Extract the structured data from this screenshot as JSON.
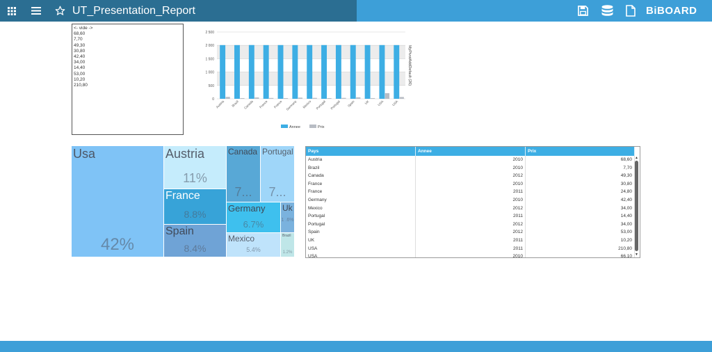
{
  "header": {
    "title": "UT_Presentation_Report",
    "brand": "BiBOARD",
    "icons": [
      "apps-grid-icon",
      "menu-icon",
      "star-icon",
      "save-icon",
      "database-icon",
      "copy-document-icon"
    ]
  },
  "colors": {
    "topbar": "#3d9fd8",
    "title_zone": "#2b6e92",
    "accent": "#3daee4"
  },
  "filter_list": {
    "items": [
      "<- vide ->",
      "68,60",
      "7,70",
      "49,30",
      "30,80",
      "42,40",
      "34,00",
      "14,40",
      "53,00",
      "10,20",
      "210,80"
    ]
  },
  "chart_data": {
    "type": "bar",
    "categories": [
      "Austria",
      "Brazil",
      "Canada",
      "France",
      "France",
      "Germany",
      "Mexico",
      "Portugal",
      "Portugal",
      "Spain",
      "UK",
      "USA",
      "USA"
    ],
    "series": [
      {
        "name": "Annee",
        "color": "#3daee4",
        "values": [
          2010,
          2010,
          2012,
          2010,
          2011,
          2010,
          2012,
          2011,
          2012,
          2012,
          2011,
          2011,
          2010
        ]
      },
      {
        "name": "Prix",
        "color": "#b8bcc4",
        "values": [
          68.6,
          7.7,
          49.3,
          30.8,
          24.8,
          42.4,
          34.0,
          14.4,
          34.0,
          53.0,
          10.2,
          210.8,
          66.1
        ]
      }
    ],
    "yticks": [
      "0",
      "500",
      "1 000",
      "1 500",
      "2 000",
      "2 500"
    ],
    "ylim": [
      0,
      2500
    ],
    "ylabel": "MyPivotAddDefault (26)",
    "grid": true,
    "legend": "bottom"
  },
  "treemap": {
    "cells": [
      {
        "name": "Usa",
        "pct": "42%",
        "color": "#7fc3f6",
        "text": "#4d5766"
      },
      {
        "name": "Austria",
        "pct": "11%",
        "color": "#c5ecfc",
        "text": "#555e6b"
      },
      {
        "name": "France",
        "pct": "8.8%",
        "color": "#37a3d8",
        "text": "#ffffff"
      },
      {
        "name": "Spain",
        "pct": "8.4%",
        "color": "#6fa3d6",
        "text": "#404a5a"
      },
      {
        "name": "Canada",
        "pct": "7...",
        "color": "#58a8d6",
        "text": "#3e4856"
      },
      {
        "name": "Portugal",
        "pct": "7...",
        "color": "#9fd6f9",
        "text": "#555e6b"
      },
      {
        "name": "Germany",
        "pct": "6.7%",
        "color": "#3ec0ee",
        "text": "#3e4856"
      },
      {
        "name": "Uk",
        "pct": "1 .6%",
        "color": "#7ab2de",
        "text": "#3e4856"
      },
      {
        "name": "Mexico",
        "pct": "5.4%",
        "color": "#bfe3fb",
        "text": "#555e6b"
      },
      {
        "name": "Brazil",
        "pct": "1.2%",
        "color": "#bfe6e8",
        "text": "#555e6b"
      }
    ]
  },
  "table": {
    "columns": [
      "Pays",
      "Annee",
      "Prix"
    ],
    "rows": [
      [
        "Austria",
        "2010",
        "68,60"
      ],
      [
        "Brazil",
        "2010",
        "7,70"
      ],
      [
        "Canada",
        "2012",
        "49,30"
      ],
      [
        "France",
        "2010",
        "30,80"
      ],
      [
        "France",
        "2011",
        "24,80"
      ],
      [
        "Germany",
        "2010",
        "42,40"
      ],
      [
        "Mexico",
        "2012",
        "34,00"
      ],
      [
        "Portugal",
        "2011",
        "14,40"
      ],
      [
        "Portugal",
        "2012",
        "34,00"
      ],
      [
        "Spain",
        "2012",
        "53,00"
      ],
      [
        "UK",
        "2011",
        "10,20"
      ],
      [
        "USA",
        "2011",
        "210,80"
      ],
      [
        "USA",
        "2010",
        "66,10"
      ]
    ]
  }
}
